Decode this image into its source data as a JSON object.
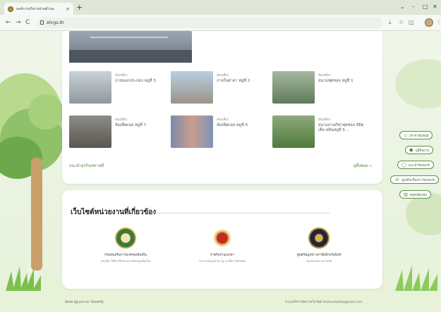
{
  "browser": {
    "tab_title": "องค์การบริหารส่วนตำบล",
    "tab_close": "×",
    "new_tab": "+",
    "url": "shrgo.th",
    "controls": {
      "minimize": "–",
      "maximize": "□",
      "close": "✕",
      "chevron": "⌄"
    },
    "nav": {
      "back": "←",
      "forward": "→",
      "reload": "C"
    },
    "addr_icons": [
      "⤓",
      "☆",
      "◫",
      "⋮"
    ]
  },
  "activities": {
    "items": [
      {
        "category": "ท่องเที่ยว",
        "title": "ภายนอกประกอบ หมู่ที่ 3"
      },
      {
        "category": "ท่องเที่ยว",
        "title": "ภายในศาลา หมู่ที่ 2"
      },
      {
        "category": "ท่องเที่ยว",
        "title": "สนามฟุตซอล หมู่ที่ 1"
      },
      {
        "category": "ท่องเที่ยว",
        "title": "ห้องฟิตเนส หมู่ที่ 7"
      },
      {
        "category": "ท่องเที่ยว",
        "title": "ห้องฟิตเนส หมู่ที่ 6"
      },
      {
        "category": "ท่องเที่ยว",
        "title": "สนามลานกีฬาฟุตซอล ลิมิตเต็ด ฟลินหมู่ที่ 5..."
      }
    ],
    "footer_left": "แนะนำธุรกิจ/สถานที่",
    "footer_right": "ดูทั้งหมด »"
  },
  "agencies": {
    "heading": "เว็บไซต์หน่วยงานที่เกี่ยวข้อง",
    "items": [
      {
        "name": "กรมส่งเสริมการปกครองท้องถิ่น",
        "sub": "ส่งเสริม ให้คำปรึกษาและสนับสนุนท้องถิ่น"
      },
      {
        "name": "ราชกิจจานุเบกษา",
        "sub": "ประกาศกฎหมาย กฎ ระเบียบ ข้อบังคับ"
      },
      {
        "name": "ศูนย์ข้อมูลข่าวสารอิเล็กทรอนิกส์",
        "sub": "ของหน่วยงานภาครัฐ"
      }
    ]
  },
  "footer": {
    "left": "ติดต่อ ผู้ดูแลระบบ โดยสหรัฐ",
    "right": "ระบบบริหารจัดการเว็บไซต์ thailandweb@gmail.com"
  },
  "side_menu": [
    {
      "icon": "megaphone-icon",
      "glyph": "◁",
      "label": "ประชาสัมพันธ์"
    },
    {
      "icon": "people-icon",
      "glyph": "☗",
      "label": "ปฏิทินงาน"
    },
    {
      "icon": "chat-icon",
      "glyph": "◯",
      "label": "แนะนำร้องทุกข์"
    },
    {
      "icon": "phone-icon",
      "glyph": "☏",
      "label": "ศูนย์รับเรื่องราวร้องทุกข์"
    },
    {
      "icon": "book-icon",
      "glyph": "▥",
      "label": "สมุดเยี่ยมชม"
    }
  ],
  "colors": {
    "accent": "#4c7d3d",
    "page_bg": "#eaf3df"
  }
}
